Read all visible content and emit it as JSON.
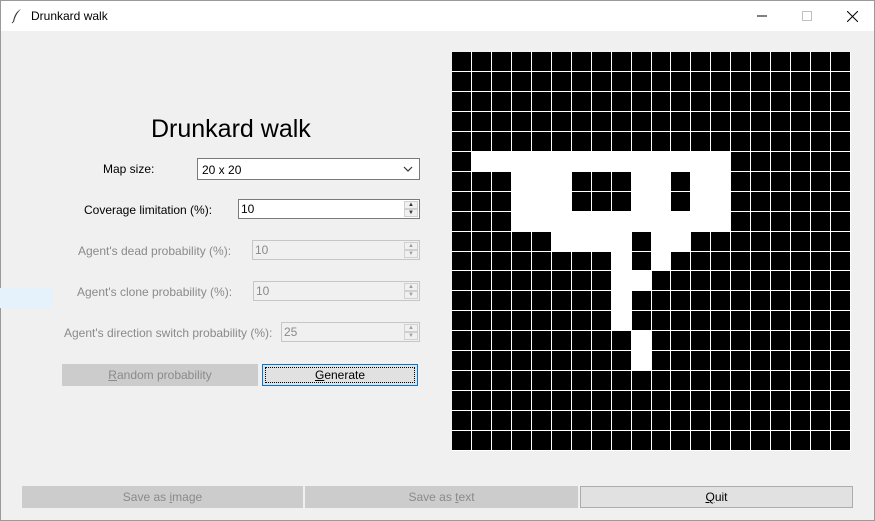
{
  "window": {
    "title": "Drunkard walk",
    "icon": "feather-icon",
    "controls": {
      "minimize": "—",
      "maximize": "☐",
      "close": "✕"
    }
  },
  "heading": "Drunkard walk",
  "form": {
    "map_size": {
      "label": "Map size:",
      "value": "20 x 20"
    },
    "coverage": {
      "label": "Coverage limitation (%):",
      "value": "10"
    },
    "dead_probability": {
      "label": "Agent's dead probability (%):",
      "value": "10",
      "disabled": true
    },
    "clone_probability": {
      "label": "Agent's clone probability (%):",
      "value": "10",
      "disabled": true
    },
    "switch_probability": {
      "label": "Agent's direction switch probability (%):",
      "value": "25",
      "disabled": true
    }
  },
  "buttons": {
    "random_probability": {
      "label": "Random probability",
      "mnemonic": "R",
      "rest": "andom probability",
      "disabled": true
    },
    "generate": {
      "label": "Generate",
      "mnemonic": "G",
      "rest": "enerate"
    },
    "save_image": {
      "label": "Save as image",
      "pre": "Save as ",
      "mnemonic": "i",
      "rest": "mage",
      "disabled": true
    },
    "save_text": {
      "label": "Save as text",
      "pre": "Save as ",
      "mnemonic": "t",
      "rest": "ext",
      "disabled": true
    },
    "quit": {
      "label": "Quit",
      "mnemonic": "Q",
      "rest": "uit"
    }
  },
  "map": {
    "rows": 20,
    "cols": 20,
    "floor_color": "#ffffff",
    "wall_color": "#000000",
    "grid": [
      "00000000000000000000",
      "00000000000000000000",
      "00000000000000000000",
      "00000000000000000000",
      "00000000000000000000",
      "01111111111111000000",
      "00011100011011000000",
      "00011100011011000000",
      "00011111111111000000",
      "00000111101100000000",
      "00000000101000000000",
      "00000000110000000000",
      "00000000100000000000",
      "00000000100000000000",
      "00000000010000000000",
      "00000000010000000000",
      "00000000000000000000",
      "00000000000000000000",
      "00000000000000000000",
      "00000000000000000000"
    ]
  }
}
